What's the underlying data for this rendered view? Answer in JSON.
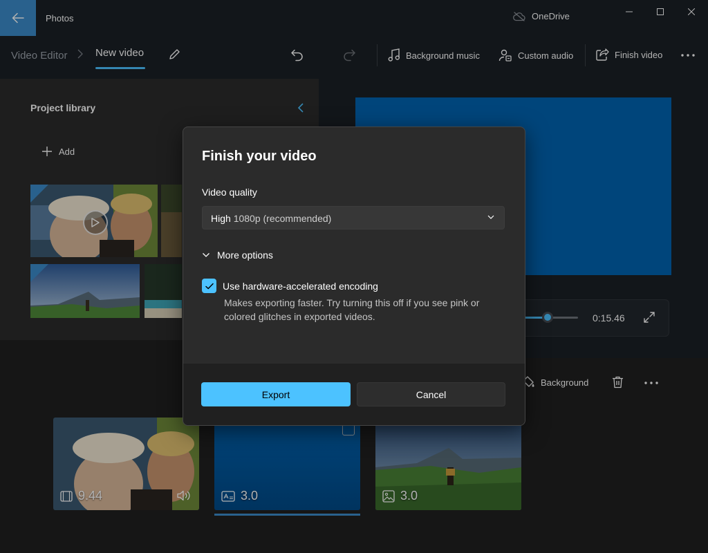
{
  "app": {
    "title": "Photos",
    "sync_label": "OneDrive"
  },
  "breadcrumb": {
    "root": "Video Editor",
    "current": "New video"
  },
  "toolbar": {
    "background_music": "Background music",
    "custom_audio": "Custom audio",
    "finish_video": "Finish video"
  },
  "library": {
    "title": "Project library",
    "add_label": "Add"
  },
  "preview": {
    "time": "0:15.46",
    "seek_fraction": 0.45,
    "canvas_color": "#0063b1"
  },
  "storyboard": {
    "background_label": "Background",
    "clips": [
      {
        "icon": "video-clip-icon",
        "duration": "9.44",
        "has_audio": true
      },
      {
        "icon": "title-card-icon",
        "duration": "3.0",
        "selected": true
      },
      {
        "icon": "image-icon",
        "duration": "3.0"
      }
    ]
  },
  "dialog": {
    "title": "Finish your video",
    "quality_label": "Video quality",
    "quality_value_main": "High",
    "quality_value_sub": "1080p (recommended)",
    "more_options": "More options",
    "hw_encoding_label": "Use hardware-accelerated encoding",
    "hw_encoding_checked": true,
    "hw_encoding_desc": "Makes exporting faster. Try turning this off if you see pink or colored glitches in exported videos.",
    "export_label": "Export",
    "cancel_label": "Cancel"
  },
  "colors": {
    "accent": "#4cc2ff",
    "brand_blue": "#3b8ccb"
  }
}
